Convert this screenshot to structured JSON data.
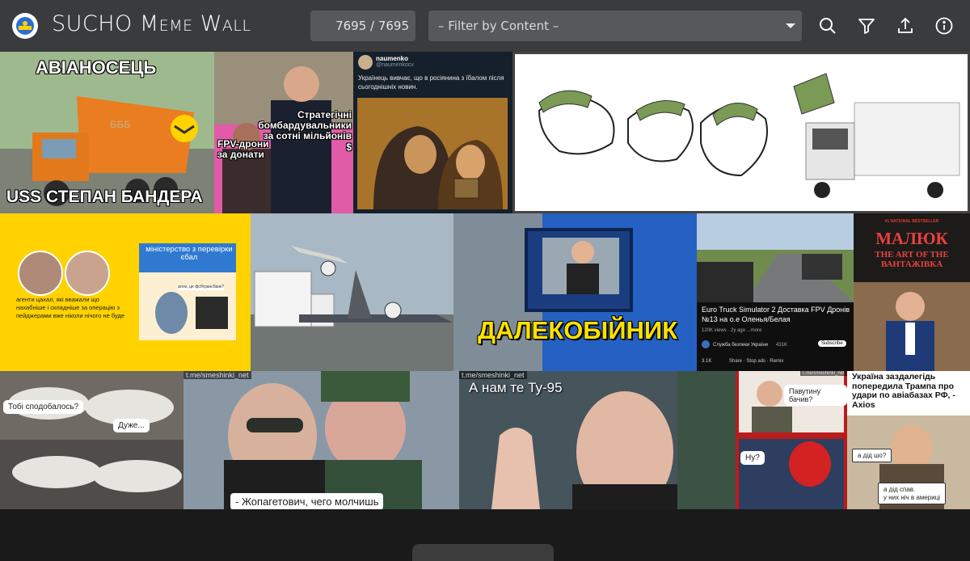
{
  "app": {
    "title_parts": [
      "SUCHO",
      "Meme",
      "Wall"
    ],
    "counter": "7695 / 7695",
    "filter_placeholder": "– Filter by Content –"
  },
  "header_icons": [
    "search-icon",
    "filter-icon",
    "upload-icon",
    "info-icon"
  ],
  "colors": {
    "header_bg": "#3a3b3d",
    "field_bg": "#56585b",
    "accent_yellow": "#ffd200"
  },
  "tiles": {
    "t1": {
      "top": "АВІАНОСЕЦЬ",
      "bottom": "USS СТЕПАН БАНДЕРА",
      "truck_label": "БББ"
    },
    "t2": {
      "cap1": "Стратегічні бомбардувальники за сотні мільйонів $",
      "cap2": "FPV-дрони за донати"
    },
    "t3": {
      "name": "naumenko",
      "handle": "@naumenkocv",
      "text": "Українець вивчає, що в росіянина з їбалом після сьогоднішніх новин."
    },
    "t5": {
      "ministry": "міністерство з перевірки єбал",
      "caption": "агенти цахал, які вважали що нахабніше і складніше за операцію з пейджерами вже ніколи нічого не буде",
      "note": "алло, це фсбтрансбанк?"
    },
    "t7": {
      "caption": "ДАЛЕКОБІЙНИК"
    },
    "t8": {
      "title": "Euro Truck Simulator 2 Доставка FPV Дронів №13 на о.е Оленья/Белая",
      "views": "120K views · 2y ago ...more",
      "channel": "Служба безпеки України",
      "subs": "431K",
      "subscribe": "Subscribe",
      "likes": "3.1K",
      "actions": "Share · Stop ads · Remix"
    },
    "t9": {
      "kicker": "#1 NATIONAL BESTSELLER",
      "title1": "МАЛЮК",
      "title2": "THE ART OF THE ВАНТАЖІВКА"
    },
    "t10": {
      "q": "Тобі сподобалось?",
      "a": "Дуже..."
    },
    "t11": {
      "watermark": "t.me/smeshinki_net",
      "subtitle": "- Жопагетович, чего молчишь"
    },
    "t12": {
      "watermark": "t.me/smeshinki_net",
      "caption": "А нам те Ту-95"
    },
    "t13": {
      "watermark": "t.me/smeshinki_net",
      "q1": "Павутину бачив?",
      "q2": "Ну?"
    },
    "t14": {
      "headline": "Україна заздалегідь попередила Трампа про удари по авіабазах РФ, - Axios",
      "b1": "а дід шо?",
      "b2": "а дід спав.\nу них ніч в америці"
    }
  }
}
